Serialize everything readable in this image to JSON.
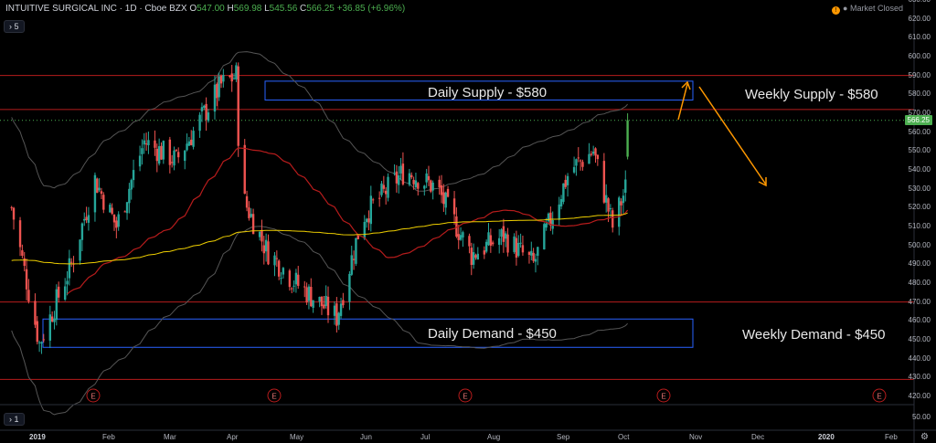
{
  "header": {
    "symbol": "INTUITIVE SURGICAL INC · 1D · Cboe BZX",
    "open_label": "O",
    "open": "547.00",
    "high_label": "H",
    "high": "569.98",
    "low_label": "L",
    "low": "545.56",
    "close_label": "C",
    "close": "566.25",
    "change": "+36.85 (+6.96%)",
    "indicator_count": "5",
    "pane2_count": "1",
    "market_status": "Market Closed"
  },
  "colors": {
    "up": "#26a69a",
    "up_bright": "#4caf50",
    "down": "#ef5350",
    "ma_red": "#b71c1c",
    "ma_yellow": "#f0d000",
    "band": "#555555",
    "zone": "#2962ff",
    "level": "#b71c1c",
    "arrow": "#ff9800"
  },
  "chart_data": {
    "type": "candlestick",
    "title": "INTUITIVE SURGICAL INC",
    "price_axis": {
      "min": 420,
      "max": 630,
      "step": 10,
      "last_price": "566.25"
    },
    "x_ticks": [
      "2019",
      "Feb",
      "Mar",
      "Apr",
      "May",
      "Jun",
      "Jul",
      "Aug",
      "Sep",
      "Oct",
      "Nov",
      "Dec",
      "2020",
      "Feb"
    ],
    "bottom_axis_tick": "50.00",
    "zones": [
      {
        "label": "Daily Supply - $580",
        "from": 577,
        "to": 587
      },
      {
        "label": "Daily Demand - $450",
        "from": 446,
        "to": 461
      }
    ],
    "levels": [
      {
        "label": "Weekly Supply - $580",
        "lines": [
          590,
          572
        ]
      },
      {
        "label": "Weekly Demand - $450",
        "lines": [
          470,
          429
        ]
      }
    ],
    "earnings_markers": [
      "E",
      "E",
      "E",
      "E",
      "E"
    ],
    "price_path": [
      {
        "t": "Jan 2",
        "p": 520
      },
      {
        "t": "Jan 15",
        "p": 448
      },
      {
        "t": "Jan 30",
        "p": 490
      },
      {
        "t": "Feb 10",
        "p": 535
      },
      {
        "t": "Feb 20",
        "p": 510
      },
      {
        "t": "Mar 5",
        "p": 555
      },
      {
        "t": "Mar 20",
        "p": 545
      },
      {
        "t": "Apr 10",
        "p": 585
      },
      {
        "t": "Apr 17",
        "p": 590
      },
      {
        "t": "Apr 19",
        "p": 528
      },
      {
        "t": "May 1",
        "p": 498
      },
      {
        "t": "May 15",
        "p": 480
      },
      {
        "t": "Jun 3",
        "p": 462
      },
      {
        "t": "Jun 15",
        "p": 515
      },
      {
        "t": "Jul 5",
        "p": 540
      },
      {
        "t": "Jul 20",
        "p": 530
      },
      {
        "t": "Aug 5",
        "p": 495
      },
      {
        "t": "Aug 20",
        "p": 505
      },
      {
        "t": "Sep 3",
        "p": 490
      },
      {
        "t": "Sep 20",
        "p": 540
      },
      {
        "t": "Oct 1",
        "p": 550
      },
      {
        "t": "Oct 10",
        "p": 510
      },
      {
        "t": "Oct 16",
        "p": 530
      },
      {
        "t": "Oct 18",
        "p": 566.25
      }
    ]
  }
}
